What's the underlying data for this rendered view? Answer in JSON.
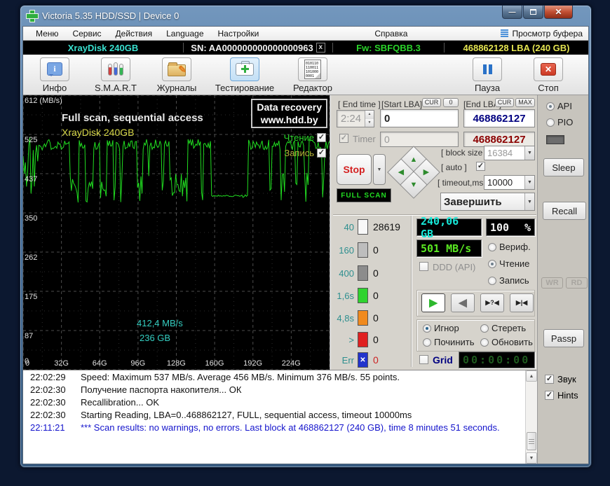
{
  "window": {
    "title": "Victoria 5.35 HDD/SSD | Device 0"
  },
  "menu": {
    "items": [
      "Меню",
      "Сервис",
      "Действия",
      "Language",
      "Настройки",
      "Справка"
    ],
    "buffer_button": "Просмотр буфера"
  },
  "device_bar": {
    "model": "XrayDisk 240GB",
    "serial": "SN: AA000000000000000963",
    "serial_close": "x",
    "firmware": "Fw: SBFQBB.3",
    "capacity": "468862128 LBA (240 GB)"
  },
  "toolbar": {
    "info": "Инфо",
    "smart": "S.M.A.R.T",
    "journals": "Журналы",
    "testing": "Тестирование",
    "editor": "Редактор",
    "pause": "Пауза",
    "stop": "Стоп",
    "editor_icon_bits": "010110 110011 101000 0001"
  },
  "graph": {
    "title": "Full scan, sequential access",
    "subtitle": "XrayDisk 240GB",
    "watermark_line1": "Data recovery",
    "watermark_line2": "www.hdd.by",
    "legend_read": "Чтение",
    "legend_write": "Запись",
    "cursor_speed": "412,4 MB/s",
    "cursor_position": "236 GB",
    "y_labels": [
      "612 (MB/s)",
      "525",
      "437",
      "350",
      "262",
      "175",
      "87",
      "0"
    ],
    "x_labels": [
      "0",
      "32G",
      "64G",
      "96G",
      "128G",
      "160G",
      "192G",
      "224G"
    ],
    "line_color": "#21dd21",
    "y_max": 612,
    "summary": {
      "max_mbs": 537,
      "avg_mbs": 456,
      "min_mbs": 376,
      "points": 55
    }
  },
  "panel": {
    "end_time_label": "[ End time ]",
    "end_time": "2:24",
    "start_lba_label": "[Start LBA]",
    "btn_cur": "CUR",
    "btn_zero": "0",
    "start_lba": "0",
    "end_lba_label": "[End LBA]",
    "btn_max": "MAX",
    "end_lba": "468862127",
    "end_lba_second": "468862127",
    "timer_label": "Timer",
    "timer_value": "0",
    "stop_button": "Stop",
    "scan_mode": "FULL SCAN",
    "block_size_label": "[ block size ]",
    "block_size": "16384",
    "auto_label": "[ auto ]",
    "timeout_label": "[ timeout,ms ]",
    "timeout": "10000",
    "action_select": "Завершить",
    "stats": [
      {
        "label": "40",
        "count": "28619",
        "color": "#f8f8f8"
      },
      {
        "label": "160",
        "count": "0",
        "color": "#bdbdbd"
      },
      {
        "label": "400",
        "count": "0",
        "color": "#8c8c8c"
      },
      {
        "label": "1,6s",
        "count": "0",
        "color": "#2fd32f"
      },
      {
        "label": "4,8s",
        "count": "0",
        "color": "#f08a1e"
      },
      {
        "label": ">",
        "count": "0",
        "color": "#e02020"
      },
      {
        "label": "Err",
        "count": "0",
        "color": "#2233cc"
      }
    ],
    "led_capacity": "240,06 GB",
    "led_percent": "100",
    "led_percent_unit": "%",
    "led_speed": "501 MB/s",
    "ddd_label": "DDD (API)",
    "radio_verify": "Вериф.",
    "radio_read": "Чтение",
    "radio_write": "Запись",
    "radio_ignore": "Игнор",
    "radio_erase": "Стереть",
    "radio_fix": "Починить",
    "radio_refresh": "Обновить",
    "grid_label": "Grid",
    "grid_timer": "00:00:00"
  },
  "sidebar": {
    "api": "API",
    "pio": "PIO",
    "sleep": "Sleep",
    "recall": "Recall",
    "wr": "WR",
    "rd": "RD",
    "passp": "Passp",
    "sound": "Звук",
    "hints": "Hints"
  },
  "log": {
    "entries": [
      {
        "time": "22:02:29",
        "text": "Speed: Maximum 537 MB/s. Average 456 MB/s. Minimum 376 MB/s. 55 points.",
        "highlight": false
      },
      {
        "time": "22:02:30",
        "text": "Получение паспорта накопителя... ОК",
        "highlight": false
      },
      {
        "time": "22:02:30",
        "text": "Recallibration... OK",
        "highlight": false
      },
      {
        "time": "22:02:30",
        "text": "Starting Reading, LBA=0..468862127, FULL, sequential access, timeout 10000ms",
        "highlight": false
      },
      {
        "time": "22:11:21",
        "text": "*** Scan results: no warnings, no errors. Last block at 468862127 (240 GB), time 8 minutes 51 seconds.",
        "highlight": true
      }
    ]
  },
  "colors": {
    "led_cyan": "#17e8d8",
    "led_green": "#5ae822",
    "led_white": "#f2f2f2",
    "value_blue": "#000080",
    "value_red": "#8b0000",
    "log_highlight": "#1414cc"
  }
}
